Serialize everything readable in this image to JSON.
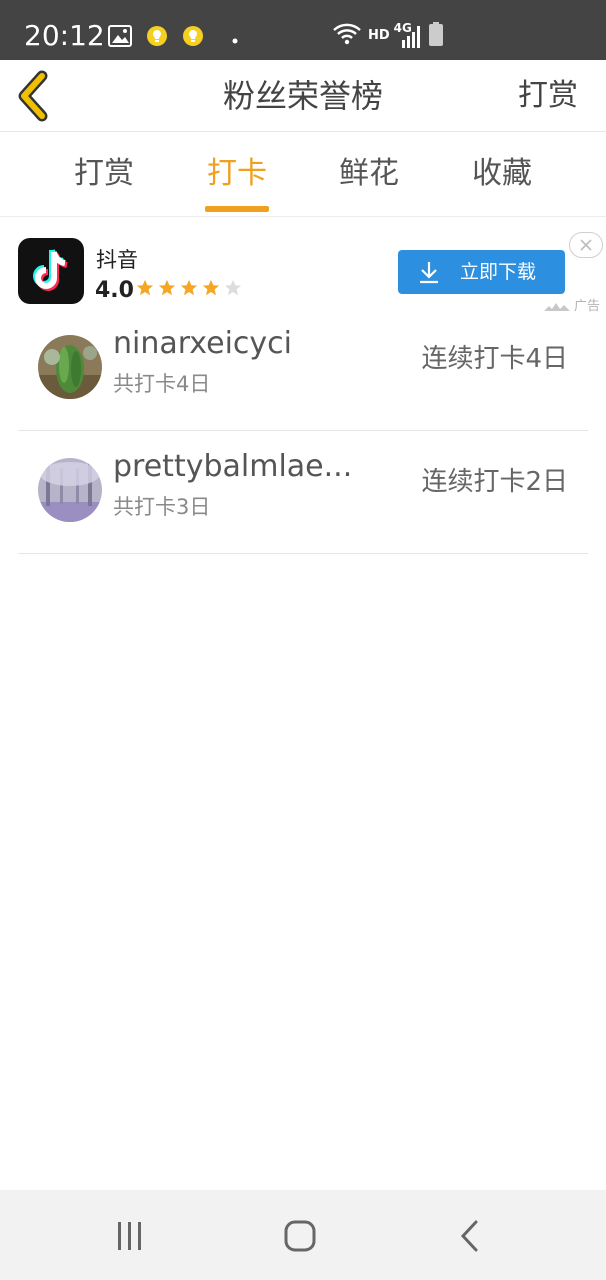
{
  "status_bar": {
    "time": "20:12",
    "network_hd": "HD",
    "network_type": "4G",
    "icons": [
      "image-icon",
      "notification-bulb-icon",
      "notification-bulb-icon",
      "dot-icon",
      "wifi-icon",
      "signal-icon",
      "battery-icon"
    ]
  },
  "header": {
    "title": "粉丝荣誉榜",
    "action_label": "打赏",
    "accent_color": "#f0c000"
  },
  "tabs": {
    "items": [
      {
        "label": "打赏",
        "active": false
      },
      {
        "label": "打卡",
        "active": true
      },
      {
        "label": "鲜花",
        "active": false
      },
      {
        "label": "收藏",
        "active": false
      }
    ],
    "active_color": "#f0a020"
  },
  "ad": {
    "app_name": "抖音",
    "rating": "4.0",
    "stars_filled": 4,
    "stars_total": 5,
    "button_label": "立即下载",
    "button_color": "#2d8fe0",
    "tag": "广告"
  },
  "fans": [
    {
      "name": "ninarxeicyci",
      "total": "共打卡4日",
      "streak": "连续打卡4日"
    },
    {
      "name": "prettybalmlae...",
      "total": "共打卡3日",
      "streak": "连续打卡2日"
    }
  ]
}
